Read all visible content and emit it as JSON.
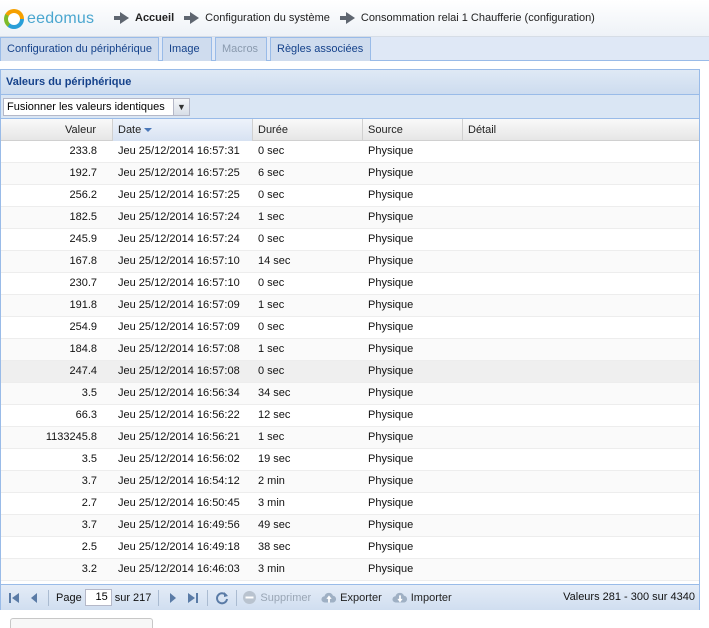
{
  "header": {
    "logo_text": "eedomus",
    "breadcrumbs": [
      "Accueil",
      "Configuration du système",
      "Consommation relai 1 Chaufferie (configuration)"
    ]
  },
  "tabs": [
    {
      "label": "Configuration du périphérique",
      "state": "normal"
    },
    {
      "label": "Image",
      "state": "normal"
    },
    {
      "label": "Macros",
      "state": "disabled"
    },
    {
      "label": "Règles associées",
      "state": "normal"
    }
  ],
  "panel": {
    "title": "Valeurs du périphérique",
    "filter_value": "Fusionner les valeurs identiques"
  },
  "grid": {
    "columns": [
      "Valeur",
      "Date",
      "Durée",
      "Source",
      "Détail"
    ],
    "rows": [
      [
        "233.8",
        "Jeu 25/12/2014 16:57:31",
        "0 sec",
        "Physique",
        ""
      ],
      [
        "192.7",
        "Jeu 25/12/2014 16:57:25",
        "6 sec",
        "Physique",
        ""
      ],
      [
        "256.2",
        "Jeu 25/12/2014 16:57:25",
        "0 sec",
        "Physique",
        ""
      ],
      [
        "182.5",
        "Jeu 25/12/2014 16:57:24",
        "1 sec",
        "Physique",
        ""
      ],
      [
        "245.9",
        "Jeu 25/12/2014 16:57:24",
        "0 sec",
        "Physique",
        ""
      ],
      [
        "167.8",
        "Jeu 25/12/2014 16:57:10",
        "14 sec",
        "Physique",
        ""
      ],
      [
        "230.7",
        "Jeu 25/12/2014 16:57:10",
        "0 sec",
        "Physique",
        ""
      ],
      [
        "191.8",
        "Jeu 25/12/2014 16:57:09",
        "1 sec",
        "Physique",
        ""
      ],
      [
        "254.9",
        "Jeu 25/12/2014 16:57:09",
        "0 sec",
        "Physique",
        ""
      ],
      [
        "184.8",
        "Jeu 25/12/2014 16:57:08",
        "1 sec",
        "Physique",
        ""
      ],
      [
        "247.4",
        "Jeu 25/12/2014 16:57:08",
        "0 sec",
        "Physique",
        ""
      ],
      [
        "3.5",
        "Jeu 25/12/2014 16:56:34",
        "34 sec",
        "Physique",
        ""
      ],
      [
        "66.3",
        "Jeu 25/12/2014 16:56:22",
        "12 sec",
        "Physique",
        ""
      ],
      [
        "1133245.8",
        "Jeu 25/12/2014 16:56:21",
        "1 sec",
        "Physique",
        ""
      ],
      [
        "3.5",
        "Jeu 25/12/2014 16:56:02",
        "19 sec",
        "Physique",
        ""
      ],
      [
        "3.7",
        "Jeu 25/12/2014 16:54:12",
        "2 min",
        "Physique",
        ""
      ],
      [
        "2.7",
        "Jeu 25/12/2014 16:50:45",
        "3 min",
        "Physique",
        ""
      ],
      [
        "3.7",
        "Jeu 25/12/2014 16:49:56",
        "49 sec",
        "Physique",
        ""
      ],
      [
        "2.5",
        "Jeu 25/12/2014 16:49:18",
        "38 sec",
        "Physique",
        ""
      ],
      [
        "3.2",
        "Jeu 25/12/2014 16:46:03",
        "3 min",
        "Physique",
        ""
      ]
    ],
    "highlighted_row": 10
  },
  "pager": {
    "page_label": "Page",
    "page_value": "15",
    "of_label": "sur 217",
    "delete_label": "Supprimer",
    "export_label": "Exporter",
    "import_label": "Importer",
    "info": "Valeurs 281 - 300 sur 4340"
  },
  "colors": {
    "header_text": "#15428b",
    "border": "#99bbe8",
    "logo": "#4aa6cf"
  }
}
